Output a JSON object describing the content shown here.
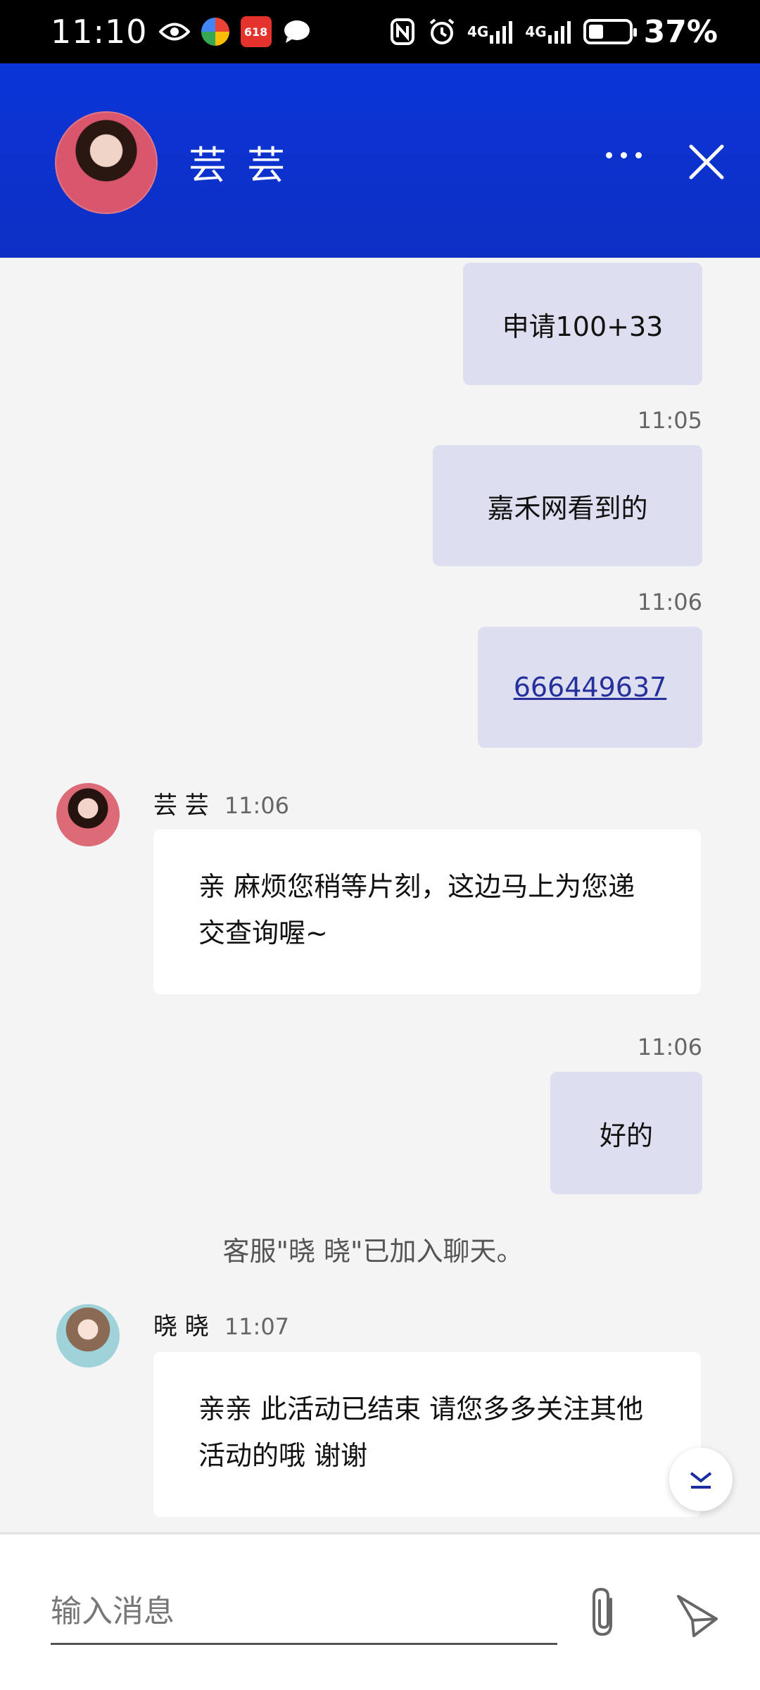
{
  "status_bar": {
    "time": "11:10",
    "network_1": "4G",
    "network_2": "4G",
    "battery_percent": "37%",
    "battery_level": 0.37,
    "app_badge": "618"
  },
  "header": {
    "contact_name": "芸 芸"
  },
  "messages": [
    {
      "type": "outgoing",
      "text": "申请100+33"
    },
    {
      "type": "outgoing",
      "time": "11:05",
      "text": "嘉禾网看到的"
    },
    {
      "type": "outgoing",
      "time": "11:06",
      "text": "666449637",
      "is_link": true
    },
    {
      "type": "incoming",
      "sender": "芸 芸",
      "time": "11:06",
      "text": "亲 麻烦您稍等片刻，这边马上为您递交查询喔~"
    },
    {
      "type": "outgoing",
      "time": "11:06",
      "text": "好的"
    },
    {
      "type": "system",
      "text": "客服\"晓 晓\"已加入聊天。"
    },
    {
      "type": "incoming",
      "sender": "晓 晓",
      "time": "11:07",
      "text": "亲亲 此活动已结束 请您多多关注其他活动的哦 谢谢"
    }
  ],
  "composer": {
    "placeholder": "输入消息"
  },
  "colors": {
    "header_blue": "#0b35d8",
    "outgoing_bubble": "#dddff0",
    "incoming_bubble": "#ffffff",
    "link": "#26309c"
  }
}
